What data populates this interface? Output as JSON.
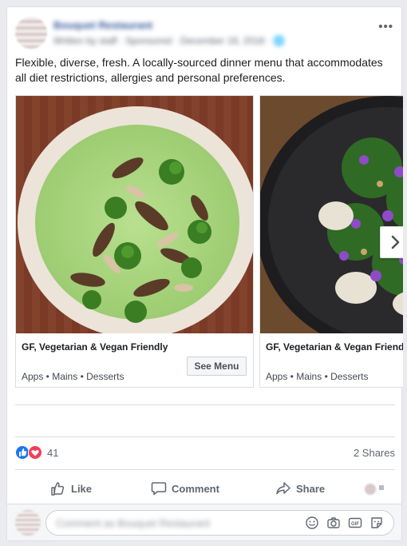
{
  "post": {
    "author": "Bouquet Restaurant",
    "meta": "Written by staff · Sponsored · December 18, 2018 · 🌐",
    "text": "Flexible, diverse, fresh. A locally-sourced dinner menu that accommodates all diet restrictions, allergies and personal preferences."
  },
  "cards": [
    {
      "title": "GF, Vegetarian & Vegan Friendly",
      "subtitle": "Apps • Mains • Desserts",
      "button": "See Menu"
    },
    {
      "title": "GF, Vegetarian & Vegan Friendly",
      "subtitle": "Apps • Mains • Desserts"
    }
  ],
  "stats": {
    "reaction_count": "41",
    "shares": "2 Shares",
    "reactions": [
      "like",
      "love"
    ]
  },
  "actions": {
    "like": "Like",
    "comment": "Comment",
    "share": "Share"
  },
  "comment": {
    "placeholder": "Comment as Bouquet Restaurant"
  },
  "colors": {
    "like_blue": "#1877f2",
    "love_red": "#f33e58",
    "link": "#365899"
  }
}
